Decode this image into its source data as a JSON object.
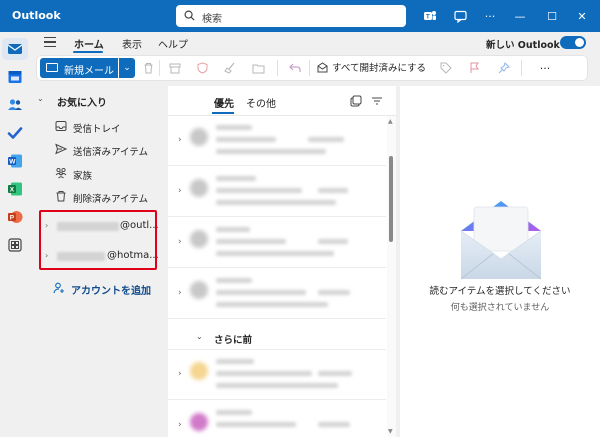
{
  "app": {
    "title": "Outlook"
  },
  "search": {
    "placeholder": "検索"
  },
  "window_controls": {
    "minimize": "—",
    "maximize": "☐",
    "close": "✕",
    "more": "···"
  },
  "tabs": [
    {
      "label": "ホーム",
      "active": true
    },
    {
      "label": "表示",
      "active": false
    },
    {
      "label": "ヘルプ",
      "active": false
    }
  ],
  "new_outlook": {
    "label": "新しい Outlook",
    "enabled": true
  },
  "ribbon": {
    "new_mail": "新規メール",
    "mark_all_read": "すべて開封済みにする",
    "more": "···"
  },
  "favorites": {
    "header": "お気に入り",
    "folders": [
      {
        "label": "受信トレイ",
        "icon": "inbox-icon"
      },
      {
        "label": "送信済みアイテム",
        "icon": "send-icon"
      },
      {
        "label": "家族",
        "icon": "people-icon"
      },
      {
        "label": "削除済みアイテム",
        "icon": "trash-icon"
      }
    ]
  },
  "accounts": [
    {
      "domain": "@outl..."
    },
    {
      "domain": "@hotma..."
    }
  ],
  "add_account": {
    "label": "アカウントを追加"
  },
  "message_list": {
    "tabs": [
      {
        "label": "優先",
        "active": true
      },
      {
        "label": "その他",
        "active": false
      }
    ],
    "section_older": "さらに前"
  },
  "reading_pane": {
    "title": "読むアイテムを選択してください",
    "subtitle": "何も選択されていません"
  },
  "colors": {
    "brand": "#0f6cbd",
    "highlight_border": "#e0001a"
  }
}
